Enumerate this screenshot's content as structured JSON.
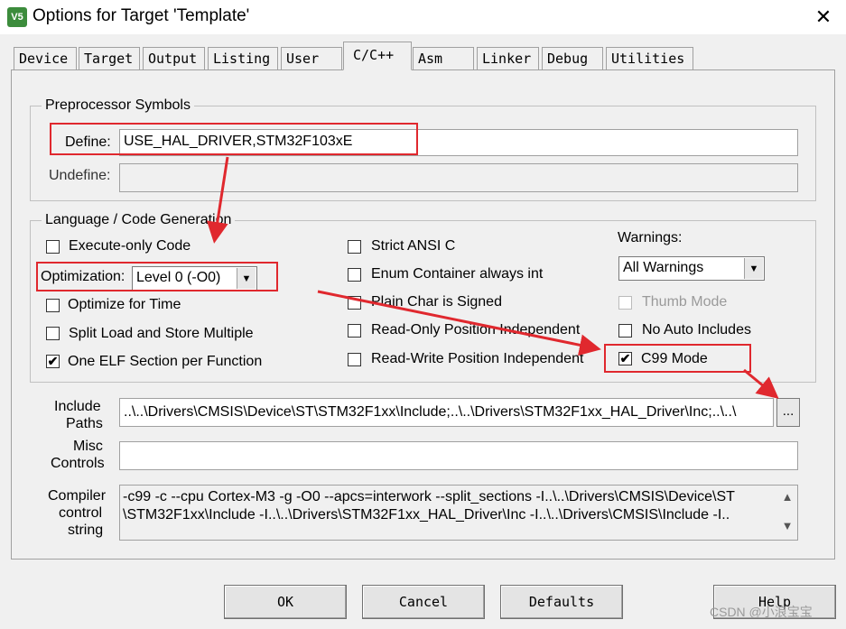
{
  "window": {
    "title": "Options for Target 'Template'",
    "app_icon_text": "V5",
    "close_glyph": "✕"
  },
  "tabs": [
    {
      "label": "Device"
    },
    {
      "label": "Target"
    },
    {
      "label": "Output"
    },
    {
      "label": "Listing"
    },
    {
      "label": "User"
    },
    {
      "label": "C/C++"
    },
    {
      "label": "Asm"
    },
    {
      "label": "Linker"
    },
    {
      "label": "Debug"
    },
    {
      "label": "Utilities"
    }
  ],
  "preprocessor": {
    "group_title": "Preprocessor Symbols",
    "define_label": "Define:",
    "define_value": "USE_HAL_DRIVER,STM32F103xE",
    "undefine_label": "Undefine:",
    "undefine_value": ""
  },
  "language": {
    "group_title": "Language / Code Generation",
    "execute_only": {
      "label": "Execute-only Code",
      "checked": false
    },
    "optimization_label": "Optimization:",
    "optimization_value": "Level 0 (-O0)",
    "optimize_time": {
      "label": "Optimize for Time",
      "checked": false
    },
    "split_load": {
      "label": "Split Load and Store Multiple",
      "checked": false
    },
    "one_elf": {
      "label": "One ELF Section per Function",
      "checked": true
    },
    "strict_ansi": {
      "label": "Strict ANSI C",
      "checked": false
    },
    "enum_container": {
      "label": "Enum Container always int",
      "checked": false
    },
    "plain_char": {
      "label": "Plain Char is Signed",
      "checked": false
    },
    "ropi": {
      "label": "Read-Only Position Independent",
      "checked": false
    },
    "rwpi": {
      "label": "Read-Write Position Independent",
      "checked": false
    },
    "warnings_label": "Warnings:",
    "warnings_value": "All Warnings",
    "thumb_mode": {
      "label": "Thumb Mode",
      "checked": false,
      "enabled": false
    },
    "no_auto_includes": {
      "label": "No Auto Includes",
      "checked": false
    },
    "c99_mode": {
      "label": "C99 Mode",
      "checked": true
    },
    "check_glyph": "✔"
  },
  "include_paths": {
    "label_line1": "Include",
    "label_line2": "Paths",
    "value": "..\\..\\Drivers\\CMSIS\\Device\\ST\\STM32F1xx\\Include;..\\..\\Drivers\\STM32F1xx_HAL_Driver\\Inc;..\\..\\",
    "browse_label": "..."
  },
  "misc_controls": {
    "label_line1": "Misc",
    "label_line2": "Controls",
    "value": ""
  },
  "compiler_control": {
    "label_line1": "Compiler",
    "label_line2": "control",
    "label_line3": "string",
    "line1": "-c99 -c --cpu Cortex-M3 -g -O0 --apcs=interwork --split_sections -I..\\..\\Drivers\\CMSIS\\Device\\ST",
    "line2": "\\STM32F1xx\\Include -I..\\..\\Drivers\\STM32F1xx_HAL_Driver\\Inc -I..\\..\\Drivers\\CMSIS\\Include -I..",
    "scroll_up_glyph": "▲",
    "scroll_down_glyph": "▼"
  },
  "buttons": {
    "ok": "OK",
    "cancel": "Cancel",
    "defaults": "Defaults",
    "help": "Help"
  },
  "combo_arrow_glyph": "▼",
  "annotation_color": "#e0282e",
  "watermark": "CSDN @小浪宝宝"
}
